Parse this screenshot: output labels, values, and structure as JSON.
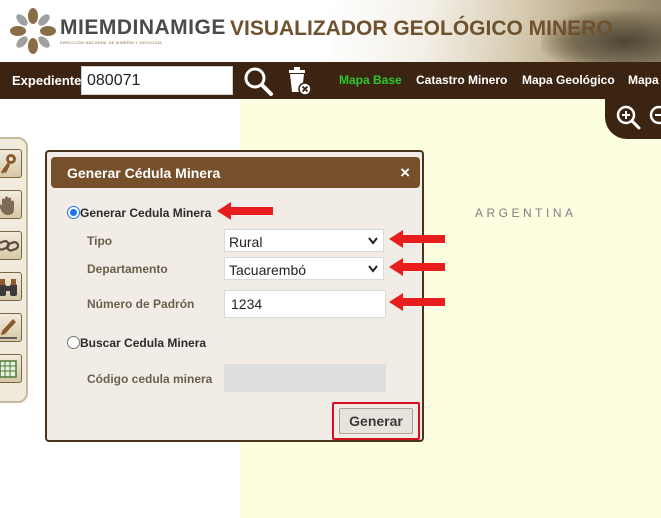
{
  "header": {
    "brand_part1": "MIEM",
    "brand_part2": "DINAMIGE",
    "brand_sub": "DIRECCIÓN NACIONAL DE MINERÍA Y GEOLOGÍA",
    "app_title": "VISUALIZADOR GEOLÓGICO MINERO",
    "logo_icon": "miem-logo-icon"
  },
  "toolbar": {
    "expediente_label": "Expediente",
    "expediente_value": "080071",
    "search_icon": "search-icon",
    "clear_icon": "trash-clear-icon",
    "links": [
      {
        "label": "Mapa Base",
        "active": true
      },
      {
        "label": "Catastro Minero",
        "active": false
      },
      {
        "label": "Mapa Geológico",
        "active": false
      },
      {
        "label": "Mapa",
        "active": false
      }
    ],
    "zoom_in_icon": "zoom-in-icon",
    "zoom_out_icon": "zoom-out-icon"
  },
  "map": {
    "label": "ARGENTINA",
    "background_color": "#fdfde0"
  },
  "left_tools": [
    {
      "icon": "key-icon"
    },
    {
      "icon": "hand-pan-icon"
    },
    {
      "icon": "chain-link-icon"
    },
    {
      "icon": "binoculars-icon"
    },
    {
      "icon": "pencil-draw-icon"
    },
    {
      "icon": "table-grid-icon"
    }
  ],
  "dialog": {
    "title": "Generar Cédula Minera",
    "close_symbol": "×",
    "option_generate": "Generar Cedula Minera",
    "option_generate_selected": true,
    "tipo_label": "Tipo",
    "tipo_value": "Rural",
    "departamento_label": "Departamento",
    "departamento_value": "Tacuarembó",
    "padron_label": "Número de Padrón",
    "padron_value": "1234",
    "option_search": "Buscar Cedula Minera",
    "option_search_selected": false,
    "codigo_label": "Código cedula minera",
    "codigo_value": "",
    "submit_label": "Generar"
  },
  "colors": {
    "toolbar_bg": "#3c2413",
    "dialog_header_bg": "#76502b",
    "active_link": "#2cc82c",
    "highlight_red": "#d3121b"
  }
}
